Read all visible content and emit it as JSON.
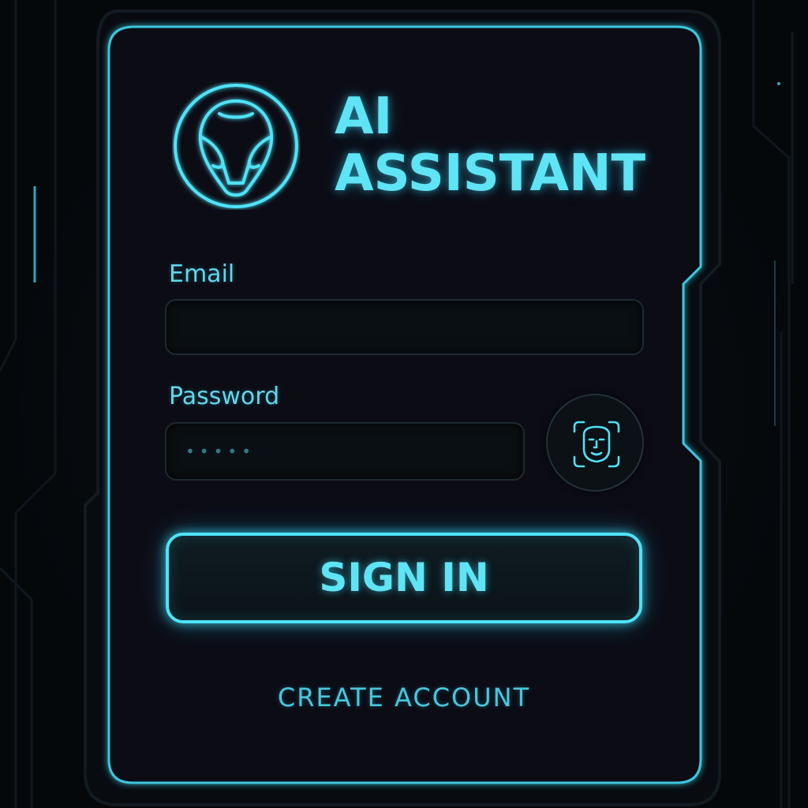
{
  "app": {
    "title_line1": "AI",
    "title_line2": "ASSISTANT"
  },
  "form": {
    "email_label": "Email",
    "email_value": "",
    "password_label": "Password",
    "password_placeholder": "•••••"
  },
  "actions": {
    "sign_in_label": "SIGN IN",
    "create_account_label": "CREATE ACCOUNT"
  },
  "icons": {
    "logo": "alien-head-logo-icon",
    "biometric": "face-id-icon"
  },
  "colors": {
    "accent": "#5fe4f5",
    "background": "#05080b",
    "input_background": "#0a0f13"
  }
}
